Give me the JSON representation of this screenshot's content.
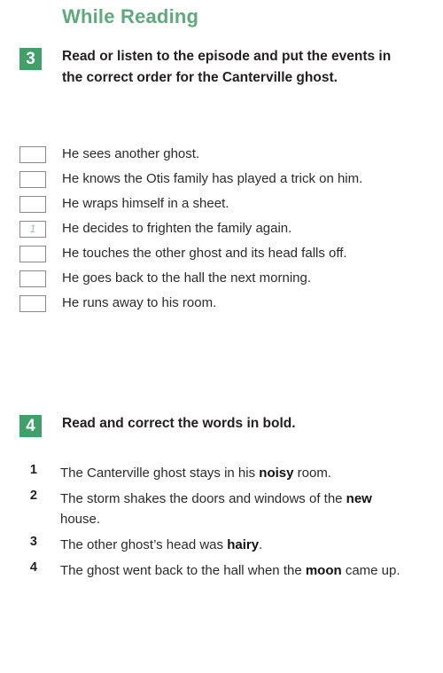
{
  "section": {
    "heading": "While Reading"
  },
  "exercises": [
    {
      "number": "3",
      "instruction": "Read or listen to the episode and put the events in the correct order for the Canterville ghost.",
      "items": [
        {
          "box_value": "",
          "text": "He sees another ghost."
        },
        {
          "box_value": "",
          "text": "He knows the Otis family has played a trick on him."
        },
        {
          "box_value": "",
          "text": "He wraps himself in a sheet."
        },
        {
          "box_value": "1",
          "text": "He decides to frighten the family again."
        },
        {
          "box_value": "",
          "text": "He touches the other ghost and its head falls off."
        },
        {
          "box_value": "",
          "text": "He goes back to the hall the next morning."
        },
        {
          "box_value": "",
          "text": "He runs away to his room."
        }
      ]
    },
    {
      "number": "4",
      "instruction": "Read and correct the words in bold.",
      "items": [
        {
          "marker": "1",
          "before": "The Canterville ghost stays in his ",
          "bold": "noisy",
          "after": " room."
        },
        {
          "marker": "2",
          "before": "The storm shakes the doors and windows of the ",
          "bold": "new",
          "after": " house."
        },
        {
          "marker": "3",
          "before": "The other ghost’s head was ",
          "bold": "hairy",
          "after": "."
        },
        {
          "marker": "4",
          "before": "The ghost went back to the hall when the ",
          "bold": "moon",
          "after": " came up."
        }
      ]
    }
  ],
  "colors": {
    "heading_green": "#5fa97d",
    "badge_green": "#41a06a",
    "body_text": "#2b2b2b",
    "checkbox_border": "#8a8a8a",
    "answer_blue": "#8fb8d8"
  }
}
